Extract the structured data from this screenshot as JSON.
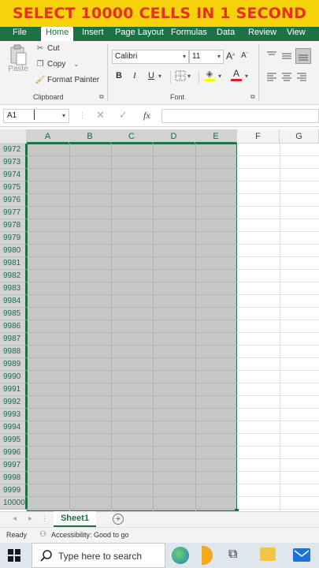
{
  "banner": {
    "text": "SELECT 10000 CELLS IN 1 SECOND"
  },
  "tabs": [
    "File",
    "Home",
    "Insert",
    "Page Layout",
    "Formulas",
    "Data",
    "Review",
    "View"
  ],
  "active_tab": "Home",
  "clipboard": {
    "paste": "Paste",
    "cut": "Cut",
    "copy": "Copy",
    "format_painter": "Format Painter",
    "label": "Clipboard"
  },
  "font": {
    "name": "Calibri",
    "size": "11",
    "label": "Font",
    "bold": "B",
    "italic": "I",
    "underline": "U",
    "grow": "A",
    "shrink": "A",
    "font_color_letter": "A"
  },
  "formula_bar": {
    "name_box": "A1",
    "fx": "fx",
    "value": ""
  },
  "columns": [
    "A",
    "B",
    "C",
    "D",
    "E",
    "F",
    "G"
  ],
  "selected_columns": [
    "A",
    "B",
    "C",
    "D",
    "E"
  ],
  "rows": [
    "9972",
    "9973",
    "9974",
    "9975",
    "9976",
    "9977",
    "9978",
    "9979",
    "9980",
    "9981",
    "9982",
    "9983",
    "9984",
    "9985",
    "9986",
    "9987",
    "9988",
    "9989",
    "9990",
    "9991",
    "9992",
    "9993",
    "9994",
    "9995",
    "9996",
    "9997",
    "9998",
    "9999",
    "10000"
  ],
  "sheet": {
    "name": "Sheet1"
  },
  "status": {
    "ready": "Ready",
    "accessibility": "Accessibility: Good to go"
  },
  "taskbar": {
    "search_placeholder": "Type here to search"
  },
  "colors": {
    "excel_green": "#1e7145",
    "banner_yellow": "#f5d20a",
    "banner_red": "#e8301f",
    "selection_gray": "#c7c7c7"
  }
}
